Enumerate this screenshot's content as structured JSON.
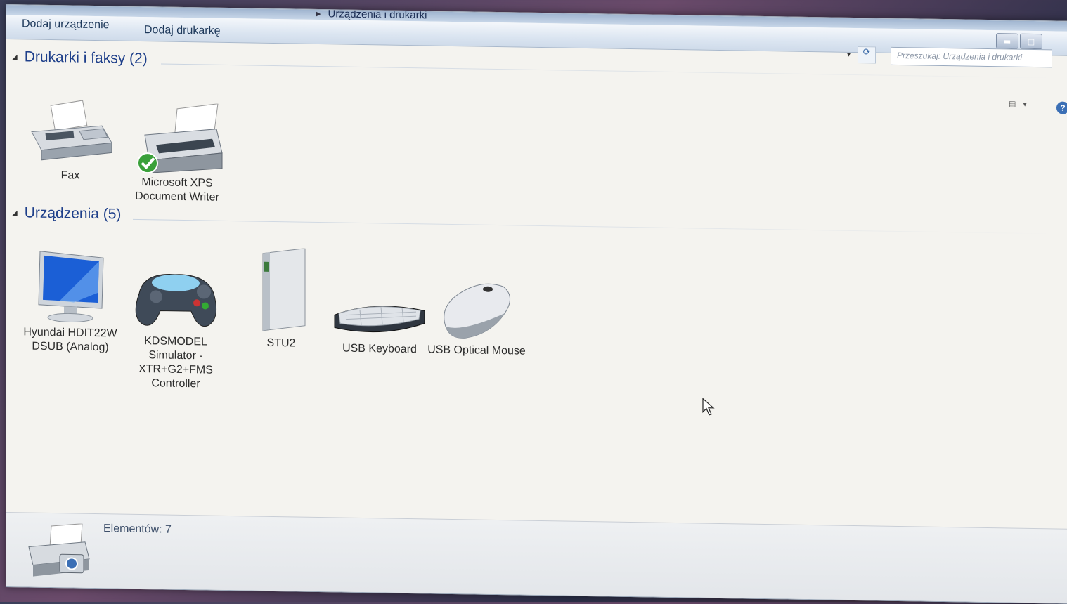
{
  "breadcrumb": {
    "current": "Urządzenia i drukarki"
  },
  "toolbar": {
    "add_device": "Dodaj urządzenie",
    "add_printer": "Dodaj drukarkę"
  },
  "search": {
    "placeholder": "Przeszukaj: Urządzenia i drukarki"
  },
  "groups": {
    "printers": {
      "title": "Drukarki i faksy (2)",
      "items": [
        {
          "label": "Fax",
          "icon": "fax-icon"
        },
        {
          "label": "Microsoft XPS Document Writer",
          "icon": "printer-icon",
          "default": true
        }
      ]
    },
    "devices": {
      "title": "Urządzenia (5)",
      "items": [
        {
          "label": "Hyundai HDIT22W DSUB (Analog)",
          "icon": "monitor-icon"
        },
        {
          "label": "KDSMODEL Simulator - XTR+G2+FMS Controller",
          "icon": "gamepad-icon"
        },
        {
          "label": "STU2",
          "icon": "drive-icon"
        },
        {
          "label": "USB Keyboard",
          "icon": "keyboard-icon"
        },
        {
          "label": "USB Optical Mouse",
          "icon": "mouse-icon"
        }
      ]
    }
  },
  "status": {
    "count_text": "Elementów: 7"
  },
  "colors": {
    "header": "#1e3f8a",
    "toolbar": "#dbe5f1",
    "background": "#f4f3ef"
  }
}
